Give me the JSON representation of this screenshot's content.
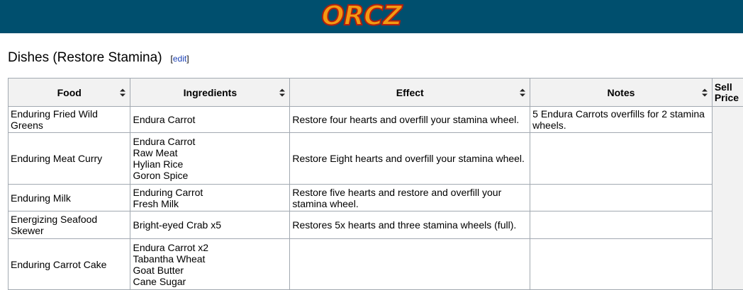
{
  "header": {
    "logo_text": "ORCZ",
    "colors": {
      "bar": "#004f6e",
      "logo_fill": "#f39a12",
      "logo_stroke": "#b21f0e"
    }
  },
  "section": {
    "title": "Dishes (Restore Stamina)",
    "edit_label": "edit"
  },
  "table": {
    "columns": [
      "Food",
      "Ingredients",
      "Effect",
      "Notes",
      "Sell Price"
    ],
    "sort_icon": "sort-arrows-icon",
    "rows": [
      {
        "food": "Enduring Fried Wild Greens",
        "ingredients": [
          "Endura Carrot"
        ],
        "effect": "Restore four hearts and overfill your stamina wheel.",
        "notes": "5 Endura Carrots overfills for 2 stamina wheels."
      },
      {
        "food": "Enduring Meat Curry",
        "ingredients": [
          "Endura Carrot",
          "Raw Meat",
          "Hylian Rice",
          "Goron Spice"
        ],
        "effect": "Restore Eight hearts and overfill your stamina wheel.",
        "notes": ""
      },
      {
        "food": "Enduring Milk",
        "ingredients": [
          "Enduring Carrot",
          "Fresh Milk"
        ],
        "effect": "Restore five hearts and restore and overfill your stamina wheel.",
        "notes": ""
      },
      {
        "food": "Energizing Seafood Skewer",
        "ingredients": [
          "Bright-eyed Crab x5"
        ],
        "effect": "Restores 5x hearts and three stamina wheels (full).",
        "notes": ""
      },
      {
        "food": "Enduring Carrot Cake",
        "ingredients": [
          "Endura Carrot x2",
          "Tabantha Wheat",
          "Goat Butter",
          "Cane Sugar"
        ],
        "effect": "",
        "notes": ""
      }
    ]
  }
}
